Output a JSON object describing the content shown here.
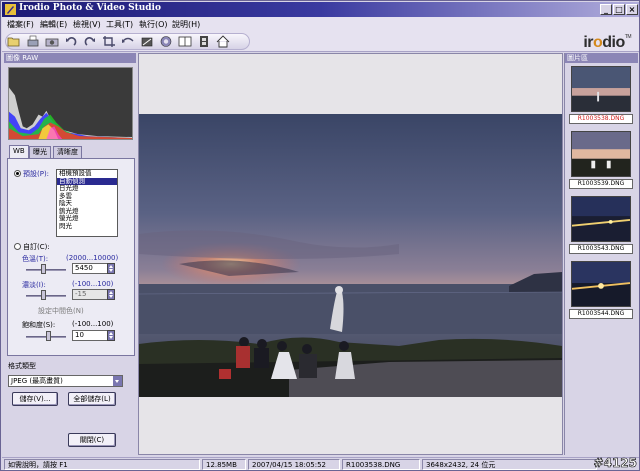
{
  "window": {
    "title": "Irodio Photo & Video Studio",
    "controls": [
      "_",
      "□",
      "×"
    ]
  },
  "menu": [
    "檔案(F)",
    "編輯(E)",
    "檢視(V)",
    "工具(T)",
    "執行(O)",
    "說明(H)"
  ],
  "toolbar": {
    "icons": [
      "open-folder-icon",
      "scanner-icon",
      "camera-icon",
      "rotate-left-icon",
      "rotate-right-icon",
      "crop-icon",
      "undo-icon",
      "enhance-icon",
      "color-icon",
      "split-view-icon",
      "filmstrip-icon",
      "home-icon"
    ]
  },
  "brand": {
    "pre": "ir",
    "o": "o",
    "post": "dio",
    "tm": "TM"
  },
  "left_panel": {
    "section_title": "圖像 RAW",
    "tabs": [
      "WB",
      "曝光",
      "清晰度"
    ],
    "preset_label": "預設(P):",
    "presets": [
      "相機預設值",
      "自動偵測",
      "日光燈",
      "多雲",
      "陰天",
      "鎢光燈",
      "螢光燈",
      "閃光"
    ],
    "selected_preset": 1,
    "custom_label": "自訂(C):",
    "color_temp": {
      "label": "色溫(T):",
      "range": "(2000...10000)",
      "value": "5450",
      "level": 0.43
    },
    "tint": {
      "label": "濃淡(I):",
      "range": "(-100...100)",
      "value": "-15",
      "level": 0.42
    },
    "neutral_label": "設定中間色(N)",
    "saturation": {
      "label": "飽和度(S):",
      "range": "(-100...100)",
      "value": "10",
      "level": 0.55
    },
    "format_label": "格式類型",
    "format_value": "JPEG (最高畫質)",
    "save_button": "儲存(V)...",
    "save_all_button": "全部儲存(L)",
    "close_button": "關閉(C)"
  },
  "right_panel": {
    "section_title": "圖片區",
    "thumbnails": [
      {
        "name": "R1003538.DNG",
        "selected": true
      },
      {
        "name": "R1003539.DNG",
        "selected": false
      },
      {
        "name": "R1003543.DNG",
        "selected": false
      },
      {
        "name": "R1003544.DNG",
        "selected": false
      }
    ]
  },
  "statusbar": {
    "help": "如需說明，請按 F1",
    "size": "12.85MB",
    "date": "2007/04/15 18:05:52",
    "file": "R1003538.DNG",
    "dims": "3648x2432, 24 位元"
  },
  "watermark": "#4125"
}
